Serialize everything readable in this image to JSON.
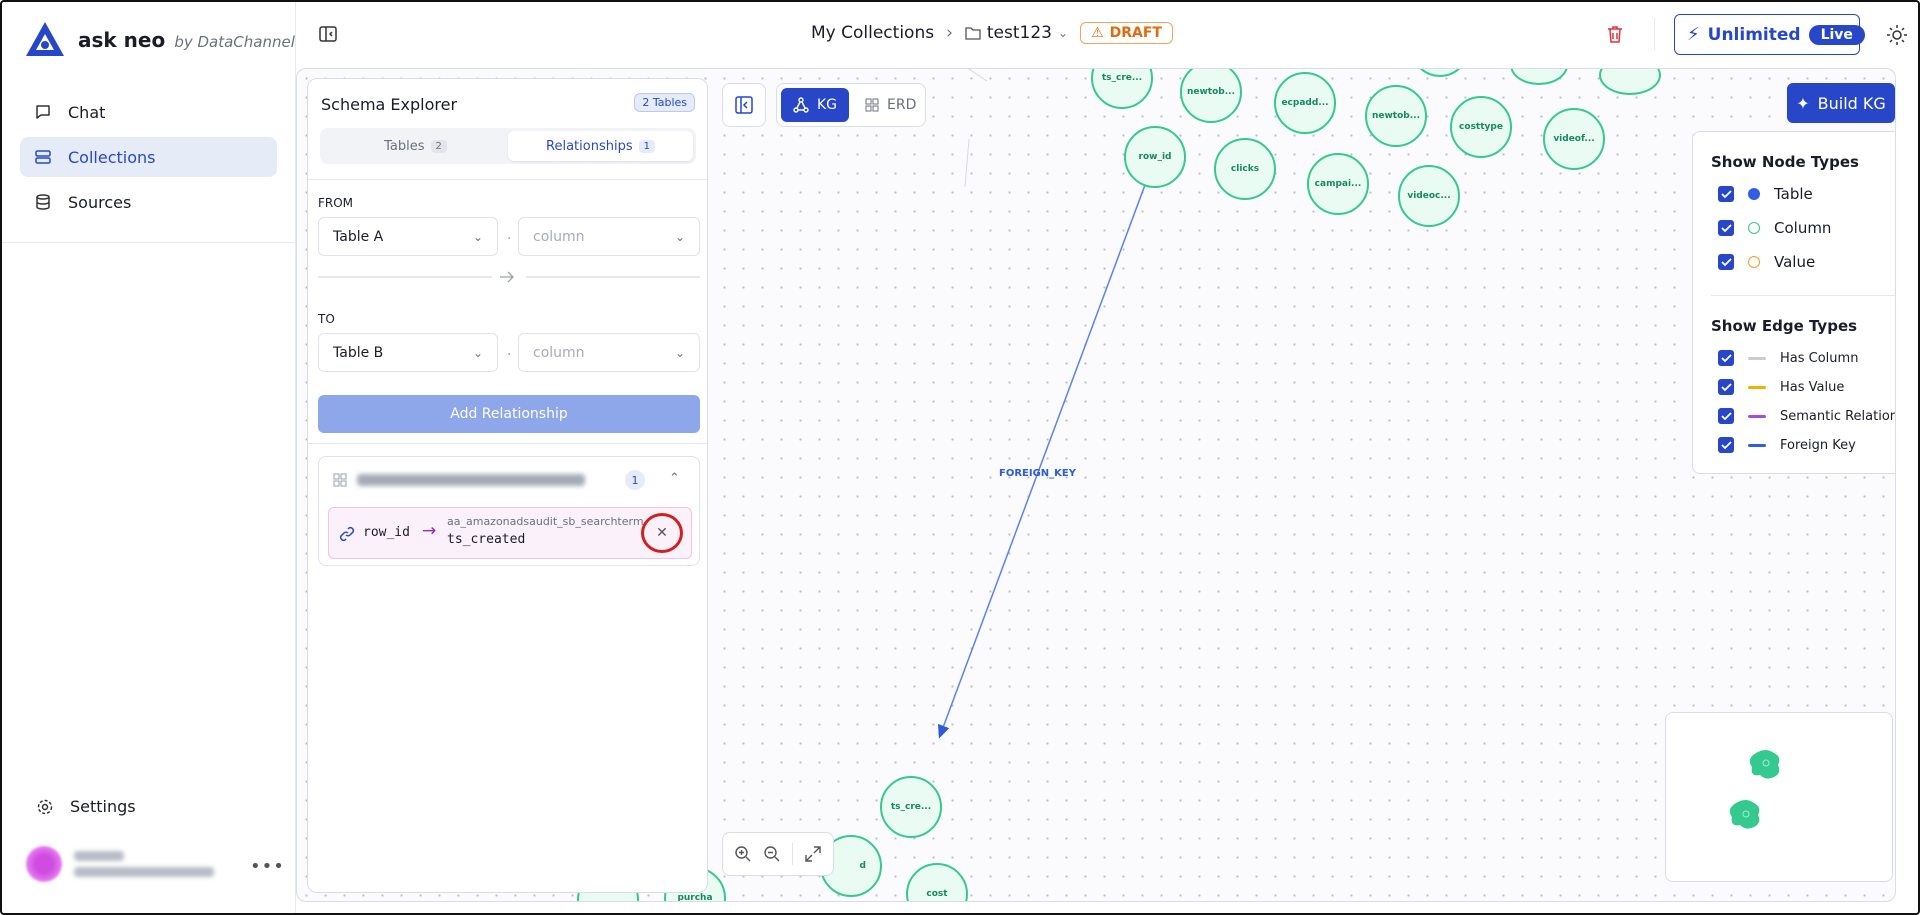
{
  "brand": {
    "name": "ask neo",
    "by": "by DataChannel"
  },
  "sidebar": {
    "items": [
      {
        "label": "Chat",
        "icon": "chat-icon"
      },
      {
        "label": "Collections",
        "icon": "collections-icon",
        "active": true
      },
      {
        "label": "Sources",
        "icon": "database-icon"
      }
    ],
    "settings_label": "Settings"
  },
  "header": {
    "breadcrumb_root": "My Collections",
    "breadcrumb_current": "test123",
    "status": "DRAFT",
    "plan_label": "Unlimited",
    "plan_badge": "Live"
  },
  "schema_explorer": {
    "title": "Schema Explorer",
    "tables_badge": "2 Tables",
    "tabs": [
      {
        "label": "Tables",
        "count": "2",
        "active": false
      },
      {
        "label": "Relationships",
        "count": "1",
        "active": true
      }
    ],
    "from_label": "FROM",
    "to_label": "TO",
    "from_table": "Table A",
    "from_column": "column",
    "to_table": "Table B",
    "to_column": "column",
    "add_button": "Add Relationship",
    "relationship_group_count": "1",
    "relationship": {
      "from_column": "row_id",
      "to_table": "aa_amazonadsaudit_sb_searchterm",
      "to_column": "ts_created"
    }
  },
  "canvas": {
    "views": [
      {
        "label": "KG",
        "active": true
      },
      {
        "label": "ERD",
        "active": false
      }
    ],
    "build_button": "Build KG",
    "edge_label": "FOREIGN_KEY",
    "nodes": [
      "ts_cre...",
      "newtob...",
      "ecpadd...",
      "newtob...",
      "costtype",
      "videof...",
      "row_id",
      "clicks",
      "campai...",
      "videoc...",
      "ts_cre...",
      "d",
      "cost",
      "purcha"
    ]
  },
  "legend": {
    "node_title": "Show Node Types",
    "node_types": [
      {
        "label": "Table",
        "color": "#2f5fe0",
        "filled": true
      },
      {
        "label": "Column",
        "color": "#34c98e",
        "filled": false
      },
      {
        "label": "Value",
        "color": "#f0a020",
        "filled": false
      }
    ],
    "edge_title": "Show Edge Types",
    "edge_types": [
      {
        "label": "Has Column",
        "color": "#c9ccd4"
      },
      {
        "label": "Has Value",
        "color": "#f0b000"
      },
      {
        "label": "Semantic Relation",
        "color": "#a24fe0"
      },
      {
        "label": "Foreign Key",
        "color": "#2f5fe0"
      }
    ]
  }
}
